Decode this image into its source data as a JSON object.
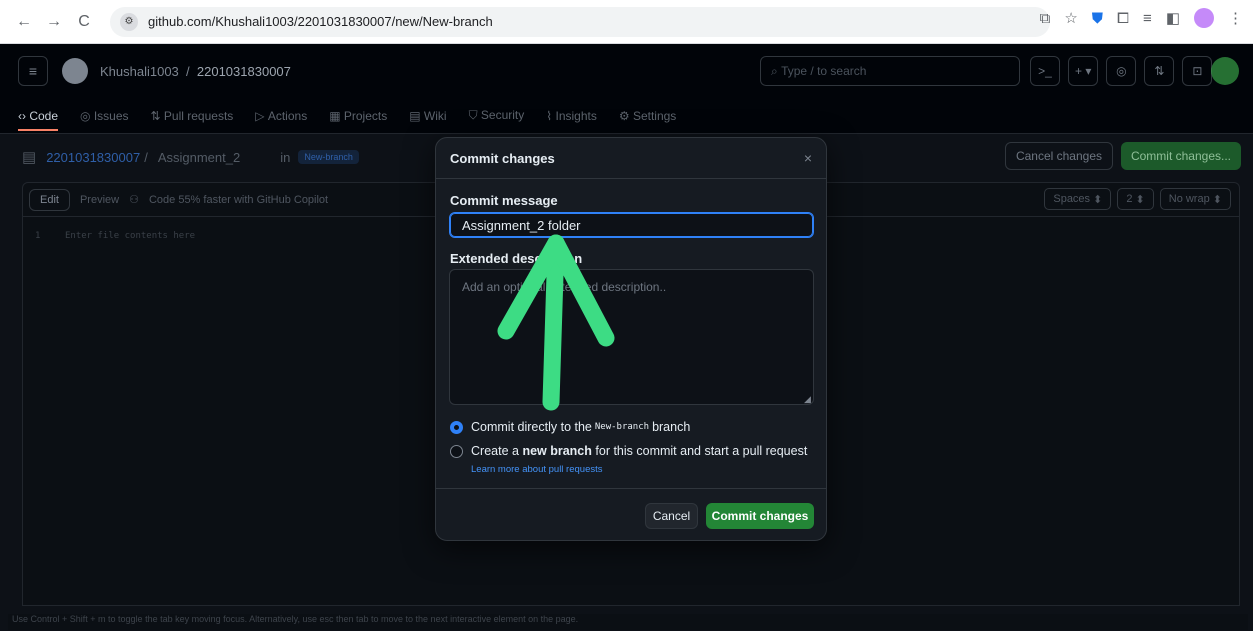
{
  "browser": {
    "url": "github.com/Khushali1003/2201031830007/new/New-branch",
    "back": "←",
    "forward": "→",
    "reload": "C"
  },
  "header": {
    "owner": "Khushali1003",
    "separator": "/",
    "repo": "2201031830007",
    "search_placeholder": "Type / to search"
  },
  "repo_tabs": [
    {
      "label": "Code"
    },
    {
      "label": "Issues"
    },
    {
      "label": "Pull requests"
    },
    {
      "label": "Actions"
    },
    {
      "label": "Projects"
    },
    {
      "label": "Wiki"
    },
    {
      "label": "Security"
    },
    {
      "label": "Insights"
    },
    {
      "label": "Settings"
    }
  ],
  "edit_row": {
    "repo_link": "2201031830007",
    "sep": "/",
    "filename": "Assignment_2",
    "in_label": "in",
    "branch": "New-branch",
    "cancel_label": "Cancel changes",
    "commit_label": "Commit changes..."
  },
  "editor": {
    "edit_tab": "Edit",
    "preview_tab": "Preview",
    "copilot": "Code 55% faster with GitHub Copilot",
    "spaces": "Spaces",
    "indent": "2",
    "wrap": "No wrap",
    "line_number": "1",
    "placeholder": "Enter file contents here",
    "footer": "Use Control + Shift + m to toggle the tab key moving focus. Alternatively, use esc then tab to move to the next interactive element on the page."
  },
  "modal": {
    "title": "Commit changes",
    "close": "×",
    "commit_message_label": "Commit message",
    "commit_message_value": "Assignment_2 folder",
    "extended_label": "Extended description",
    "extended_placeholder": "Add an optional extended description..",
    "option_direct_prefix": "Commit directly to the",
    "option_direct_branch": "New-branch",
    "option_direct_suffix": "branch",
    "option_new_prefix": "Create a",
    "option_new_bold": "new branch",
    "option_new_suffix": "for this commit and start a pull request",
    "learn_more": "Learn more about pull requests",
    "cancel": "Cancel",
    "commit": "Commit changes"
  },
  "colors": {
    "arrow": "#3ddc84",
    "primary": "#238636",
    "focus": "#2f81f7"
  }
}
